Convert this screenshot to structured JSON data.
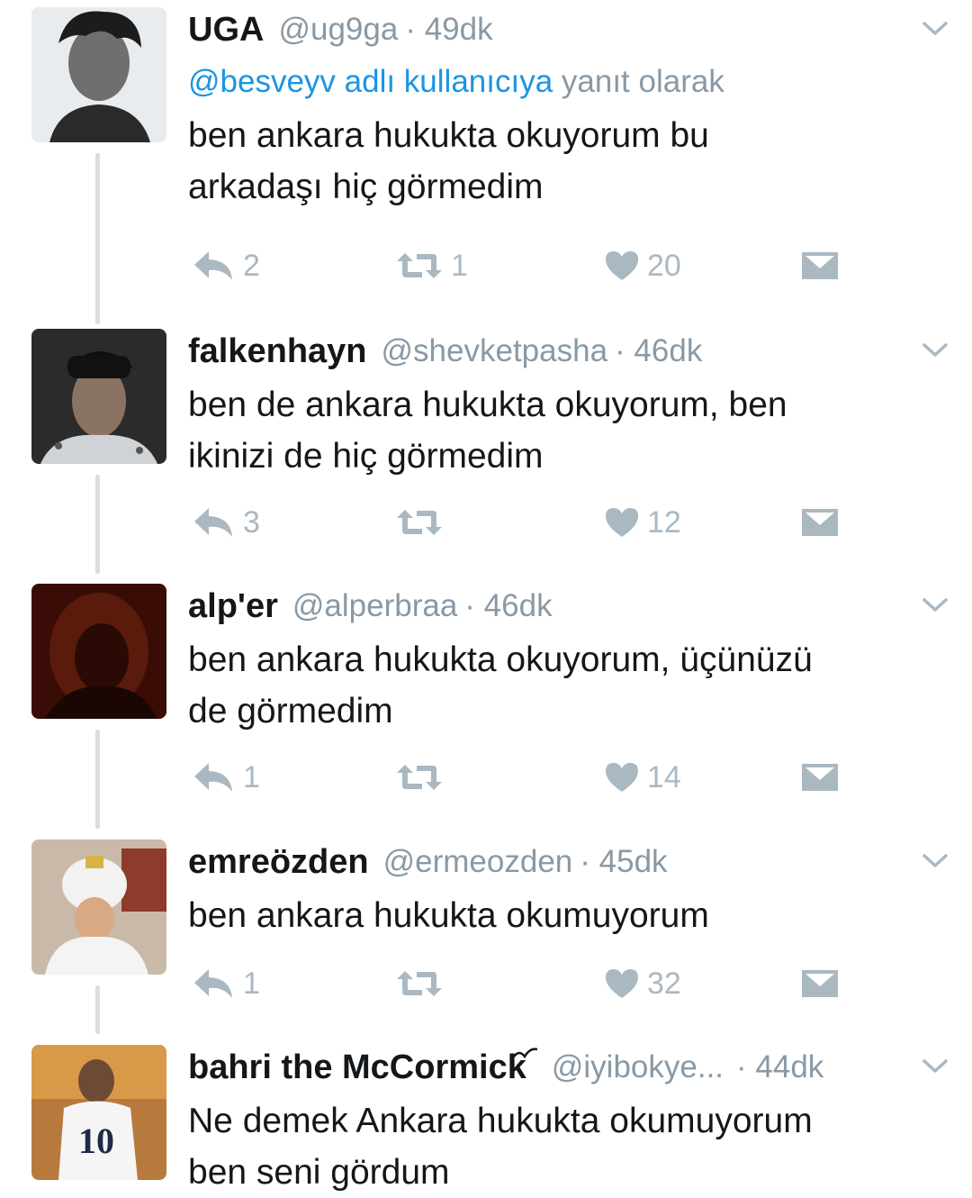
{
  "tweets": [
    {
      "name": "UGA",
      "handle": "@ug9ga",
      "time": "· 49dk",
      "reply_to_mention": "@besveyv adlı kullanıcıya",
      "reply_to_suffix": " yanıt olarak",
      "text": "ben ankara hukukta okuyorum bu\narkadaşı hiç görmedim",
      "replies": "2",
      "retweets": "1",
      "likes": "20"
    },
    {
      "name": "falkenhayn",
      "handle": "@shevketpasha",
      "time": "· 46dk",
      "text": "ben de ankara hukukta okuyorum, ben\nikinizi de hiç görmedim",
      "replies": "3",
      "retweets": "",
      "likes": "12"
    },
    {
      "name": "alp'er",
      "handle": "@alperbraa",
      "time": "· 46dk",
      "text": "ben ankara hukukta okuyorum, üçünüzü\nde görmedim",
      "replies": "1",
      "retweets": "",
      "likes": "14"
    },
    {
      "name": "emreözden",
      "handle": "@ermeozden",
      "time": "· 45dk",
      "text": "ben ankara hukukta okumuyorum",
      "replies": "1",
      "retweets": "",
      "likes": "32"
    },
    {
      "name": "bahri the McCormick",
      "handle": "@iyibokye...",
      "time": " · 44dk",
      "text": "Ne demek Ankara hukukta okumuyorum\nben seni gördum"
    }
  ],
  "colors": {
    "muted": "#8899a6",
    "link": "#1b95e0",
    "icon": "#aab8c2",
    "thread_line": "#d9dee3"
  },
  "icons": [
    "reply-icon",
    "retweet-icon",
    "heart-icon",
    "direct-message-icon",
    "chevron-down-icon"
  ]
}
